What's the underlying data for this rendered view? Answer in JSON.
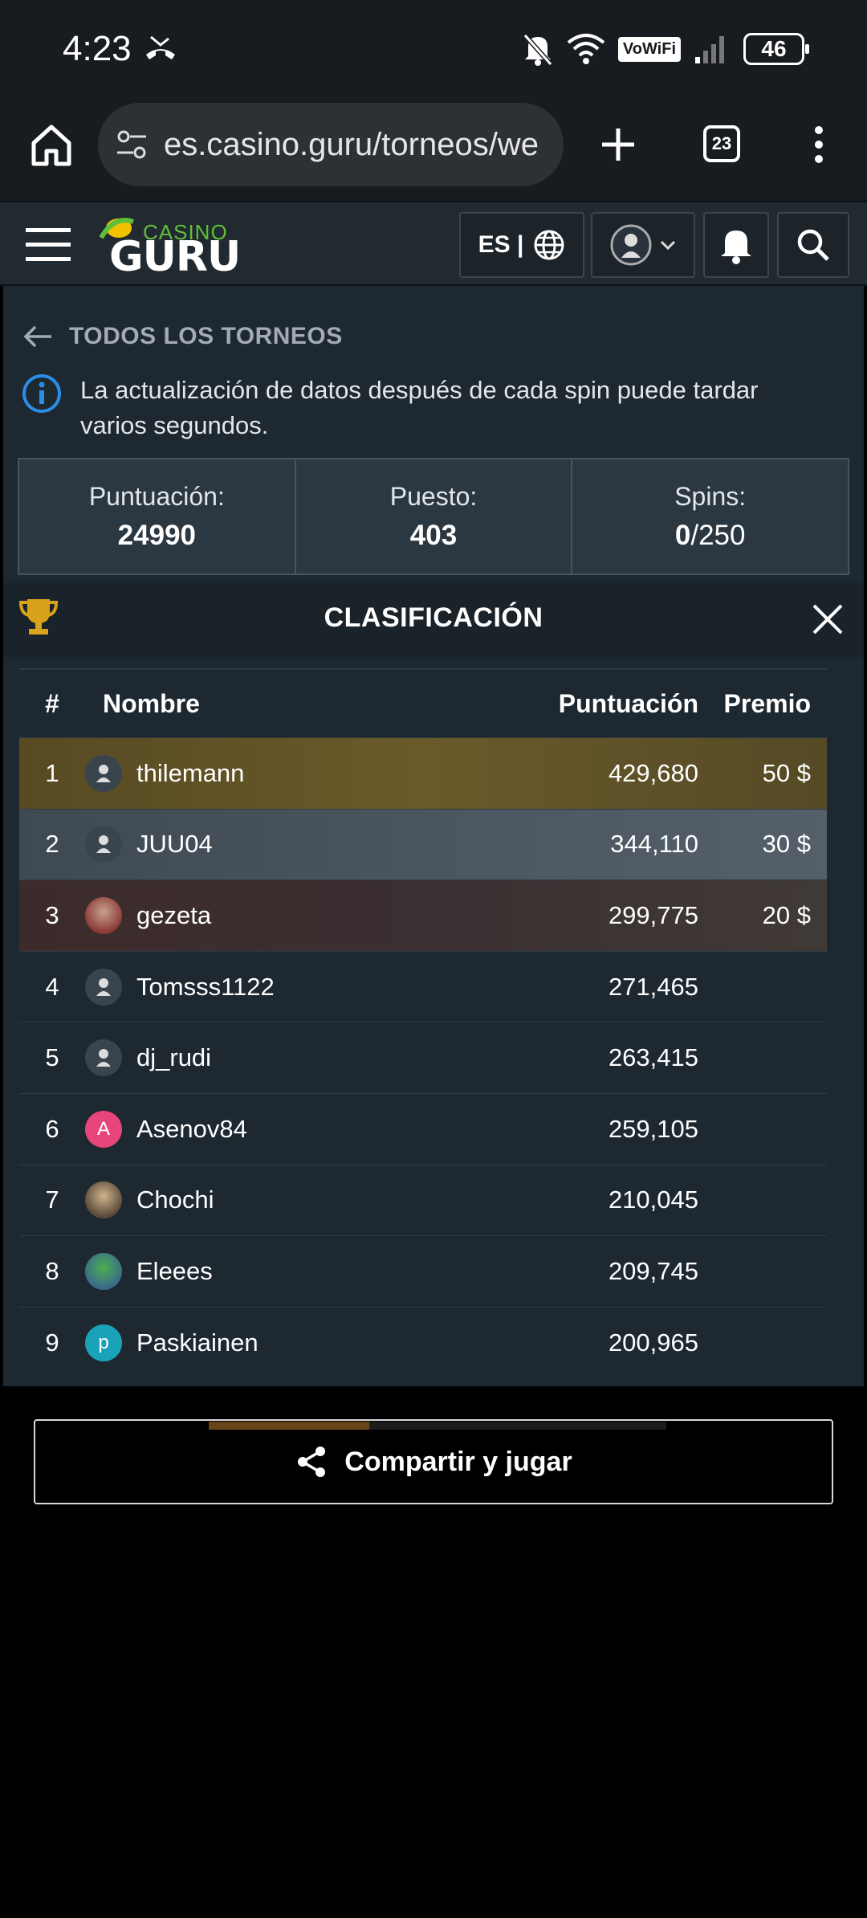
{
  "status_bar": {
    "time": "4:23",
    "vowifi": "VoWiFi",
    "battery": "46",
    "icons": [
      "missed-call-icon",
      "mute-bell-icon",
      "wifi-icon",
      "signal-icon",
      "battery-icon"
    ]
  },
  "browser": {
    "url": "es.casino.guru/torneos/we",
    "tab_count": "23"
  },
  "site_header": {
    "logo_casino": "CASINO",
    "logo_guru": "GURU",
    "lang": "ES |",
    "accent_color": "#5fbf3a"
  },
  "page": {
    "back_label": "TODOS LOS TORNEOS",
    "info_text": "La actualización de datos después de cada spin puede tardar varios segundos.",
    "stats": {
      "score_label": "Puntuación:",
      "score_value": "24990",
      "rank_label": "Puesto:",
      "rank_value": "403",
      "spins_label": "Spins:",
      "spins_used": "0",
      "spins_total": "/250"
    },
    "leaderboard": {
      "title": "CLASIFICACIÓN",
      "headers": {
        "rank": "#",
        "name": "Nombre",
        "score": "Puntuación",
        "prize": "Premio"
      },
      "rows": [
        {
          "rank": "1",
          "name": "thilemann",
          "score": "429,680",
          "prize": "50 $",
          "avatar": "default"
        },
        {
          "rank": "2",
          "name": "JUU04",
          "score": "344,110",
          "prize": "30 $",
          "avatar": "default"
        },
        {
          "rank": "3",
          "name": "gezeta",
          "score": "299,775",
          "prize": "20 $",
          "avatar": "photo"
        },
        {
          "rank": "4",
          "name": "Tomsss1122",
          "score": "271,465",
          "prize": "",
          "avatar": "default"
        },
        {
          "rank": "5",
          "name": "dj_rudi",
          "score": "263,415",
          "prize": "",
          "avatar": "default"
        },
        {
          "rank": "6",
          "name": "Asenov84",
          "score": "259,105",
          "prize": "",
          "avatar": "A"
        },
        {
          "rank": "7",
          "name": "Chochi",
          "score": "210,045",
          "prize": "",
          "avatar": "photo"
        },
        {
          "rank": "8",
          "name": "Eleees",
          "score": "209,745",
          "prize": "",
          "avatar": "photo"
        },
        {
          "rank": "9",
          "name": "Paskiainen",
          "score": "200,965",
          "prize": "",
          "avatar": "p"
        }
      ]
    },
    "share_button": "Compartir y jugar",
    "share_progress": 0.35
  }
}
